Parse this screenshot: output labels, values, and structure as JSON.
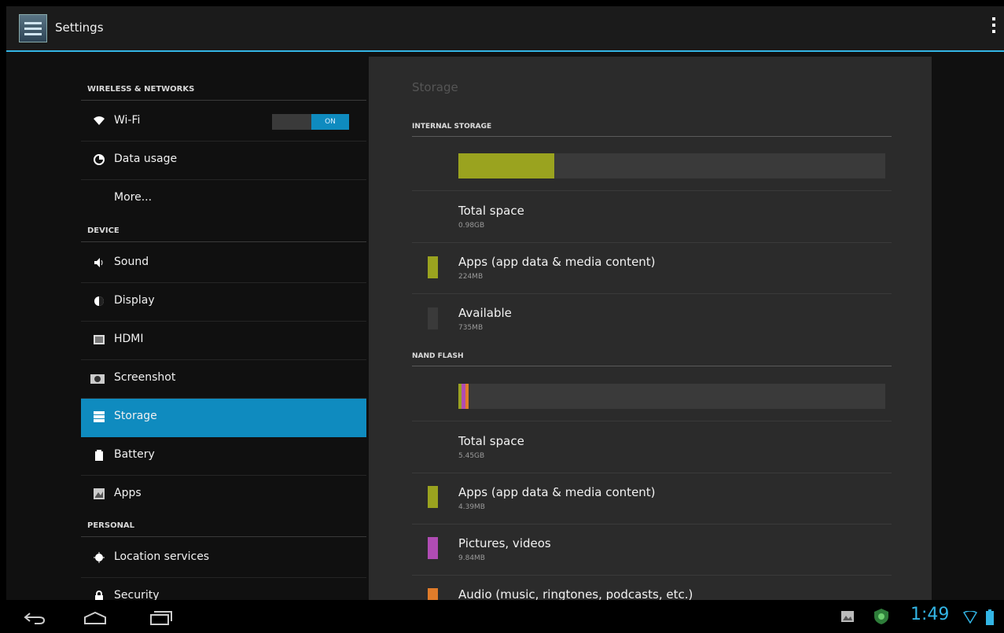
{
  "actionbar": {
    "title": "Settings",
    "icon": "settings-app-icon",
    "overflow_icon": "overflow-menu-icon"
  },
  "left": {
    "headers": {
      "wireless": "WIRELESS & NETWORKS",
      "device": "DEVICE",
      "personal": "PERSONAL"
    },
    "items": {
      "wifi": {
        "label": "Wi-Fi",
        "toggle": "ON",
        "icon": "wifi-icon"
      },
      "data_usage": {
        "label": "Data usage",
        "icon": "data-usage-icon"
      },
      "more": {
        "label": "More..."
      },
      "sound": {
        "label": "Sound",
        "icon": "sound-icon"
      },
      "display": {
        "label": "Display",
        "icon": "display-icon"
      },
      "hdmi": {
        "label": "HDMI",
        "icon": "hdmi-icon"
      },
      "screenshot": {
        "label": "Screenshot",
        "icon": "camera-icon"
      },
      "storage": {
        "label": "Storage",
        "icon": "storage-icon",
        "selected": true
      },
      "battery": {
        "label": "Battery",
        "icon": "battery-icon"
      },
      "apps": {
        "label": "Apps",
        "icon": "apps-icon"
      },
      "location": {
        "label": "Location services",
        "icon": "location-icon"
      },
      "security": {
        "label": "Security",
        "icon": "lock-icon"
      }
    }
  },
  "storage": {
    "title": "Storage",
    "internal": {
      "header": "INTERNAL STORAGE",
      "usage_fraction": 0.225,
      "total_title": "Total space",
      "total_value": "0.98GB",
      "apps_title": "Apps (app data & media content)",
      "apps_value": "224MB",
      "available_title": "Available",
      "available_value": "735MB"
    },
    "nand": {
      "header": "NAND FLASH",
      "usage": [
        0.006,
        0.01,
        0.003
      ],
      "total_title": "Total space",
      "total_value": "5.45GB",
      "apps_title": "Apps (app data & media content)",
      "apps_value": "4.39MB",
      "pictures_title": "Pictures, videos",
      "pictures_value": "9.84MB",
      "audio_title": "Audio (music, ringtones, podcasts, etc.)"
    }
  },
  "colors": {
    "accent": "#33b5e5",
    "apps": "#9aa31f",
    "pictures": "#b04cb4",
    "audio": "#e07c2a",
    "available": "#3a3a3a",
    "selected": "#0f8bbf"
  },
  "navbar": {
    "back_icon": "back-icon",
    "home_icon": "home-icon",
    "recents_icon": "recents-icon",
    "clock": "1:49"
  }
}
